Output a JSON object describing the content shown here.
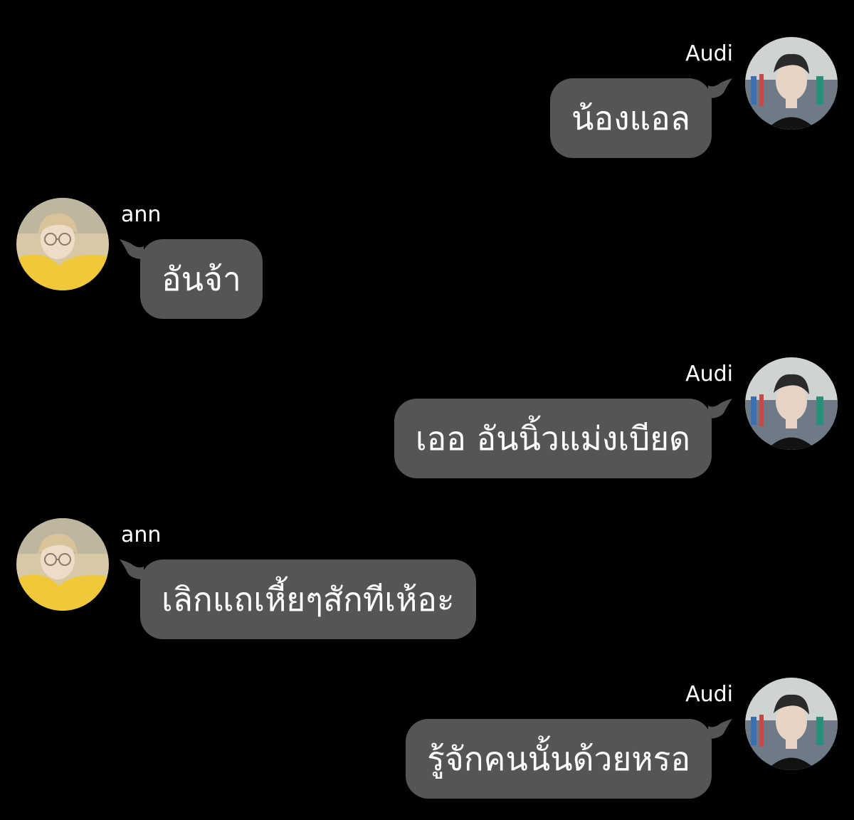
{
  "messages": [
    {
      "side": "out",
      "sender": "Audi",
      "text": "น้องแอล",
      "avatar": "audi-avatar"
    },
    {
      "side": "in",
      "sender": "ann",
      "text": "อันจ้า",
      "avatar": "ann-avatar"
    },
    {
      "side": "out",
      "sender": "Audi",
      "text": "เออ อันนิ้วแม่งเบียด",
      "avatar": "audi-avatar"
    },
    {
      "side": "in",
      "sender": "ann",
      "text": "เลิกแถเหี้ยๆสักทีเห้อะ",
      "avatar": "ann-avatar"
    },
    {
      "side": "out",
      "sender": "Audi",
      "text": "รู้จักคนนั้นด้วยหรอ",
      "avatar": "audi-avatar"
    }
  ],
  "colors": {
    "background": "#000000",
    "bubble": "#555555",
    "text": "#ffffff"
  }
}
